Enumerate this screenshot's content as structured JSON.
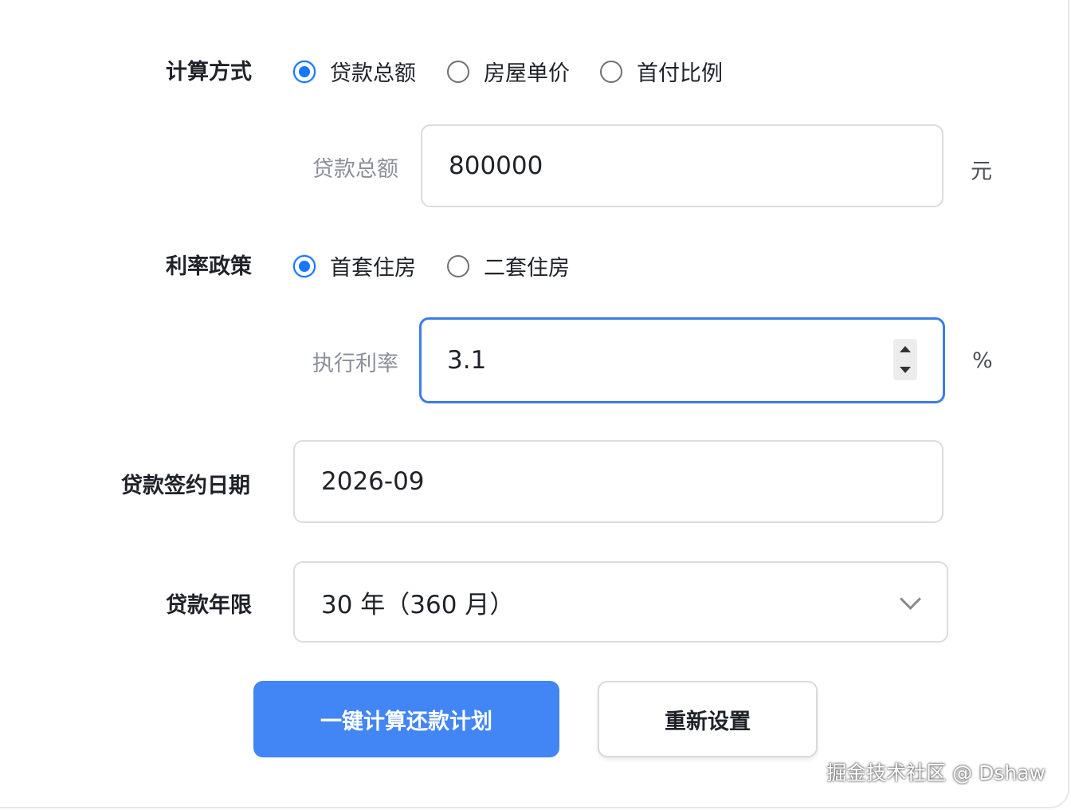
{
  "calc_method": {
    "label": "计算方式",
    "options": [
      "贷款总额",
      "房屋单价",
      "首付比例"
    ],
    "selected_index": 0
  },
  "loan_amount": {
    "label": "贷款总额",
    "value": "800000",
    "unit": "元"
  },
  "rate_policy": {
    "label": "利率政策",
    "options": [
      "首套住房",
      "二套住房"
    ],
    "selected_index": 0
  },
  "exec_rate": {
    "label": "执行利率",
    "value": "3.1",
    "unit": "%"
  },
  "sign_date": {
    "label": "贷款签约日期",
    "value": "2026-09"
  },
  "loan_term": {
    "label": "贷款年限",
    "value": "30 年（360 月）"
  },
  "buttons": {
    "calculate": "一键计算还款计划",
    "reset": "重新设置"
  },
  "watermark": "掘金技术社区 @ Dshaw",
  "colors": {
    "accent": "#1677ff",
    "primary_button": "#4285f4",
    "focus_border": "#3a7ee8"
  }
}
